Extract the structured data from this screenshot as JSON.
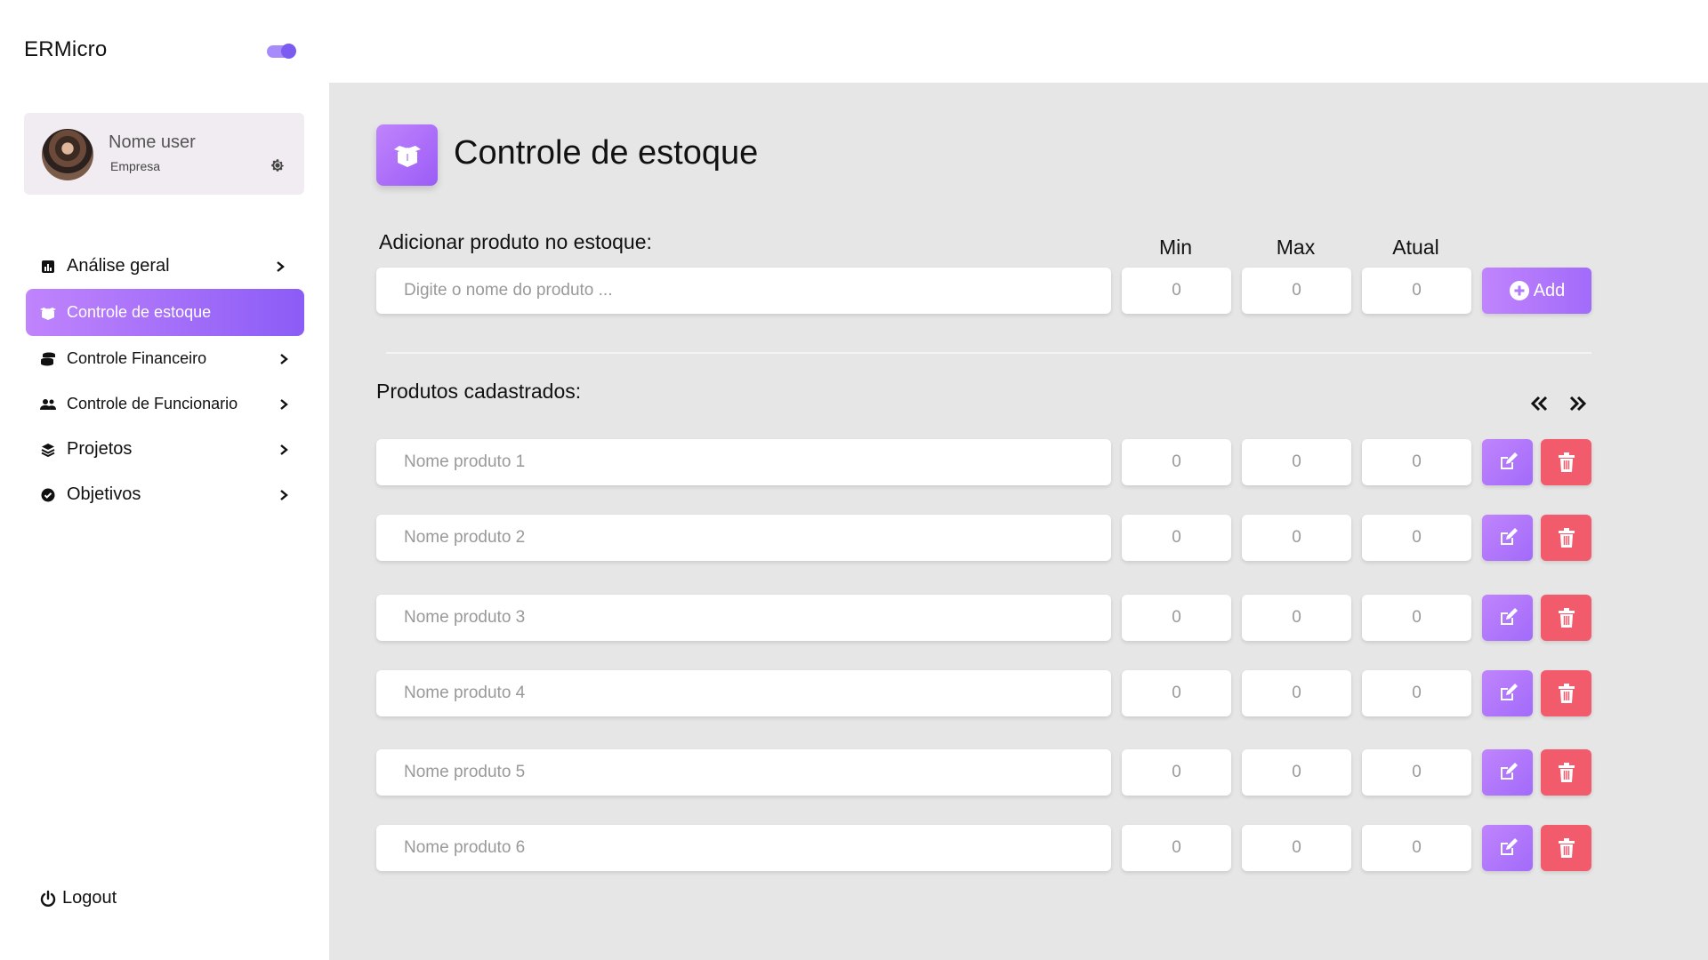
{
  "app": {
    "brand": "ERMicro"
  },
  "user": {
    "name": "Nome user",
    "company": "Empresa"
  },
  "nav": {
    "items": [
      {
        "label": "Análise geral",
        "icon": "chart-icon"
      },
      {
        "label": "Controle de estoque",
        "icon": "box-icon",
        "active": true
      },
      {
        "label": "Controle Financeiro",
        "icon": "coins-icon"
      },
      {
        "label": "Controle de Funcionario",
        "icon": "users-icon"
      },
      {
        "label": "Projetos",
        "icon": "layers-icon"
      },
      {
        "label": "Objetivos",
        "icon": "check-circle-icon"
      }
    ],
    "logout": "Logout"
  },
  "page": {
    "title": "Controle de estoque"
  },
  "add_form": {
    "label": "Adicionar produto no estoque:",
    "name_placeholder": "Digite o nome do produto ...",
    "col_min": "Min",
    "col_max": "Max",
    "col_atual": "Atual",
    "min_value": "0",
    "max_value": "0",
    "atual_value": "0",
    "add_label": "Add"
  },
  "products": {
    "label": "Produtos cadastrados:",
    "rows": [
      {
        "name": "Nome produto 1",
        "min": "0",
        "max": "0",
        "atual": "0"
      },
      {
        "name": "Nome produto 2",
        "min": "0",
        "max": "0",
        "atual": "0"
      },
      {
        "name": "Nome produto 3",
        "min": "0",
        "max": "0",
        "atual": "0"
      },
      {
        "name": "Nome produto 4",
        "min": "0",
        "max": "0",
        "atual": "0"
      },
      {
        "name": "Nome produto 5",
        "min": "0",
        "max": "0",
        "atual": "0"
      },
      {
        "name": "Nome produto 6",
        "min": "0",
        "max": "0",
        "atual": "0"
      }
    ]
  },
  "colors": {
    "accent_purple": "#a26bfa",
    "delete_red": "#f25b6c",
    "main_bg": "#e6e6e6"
  }
}
